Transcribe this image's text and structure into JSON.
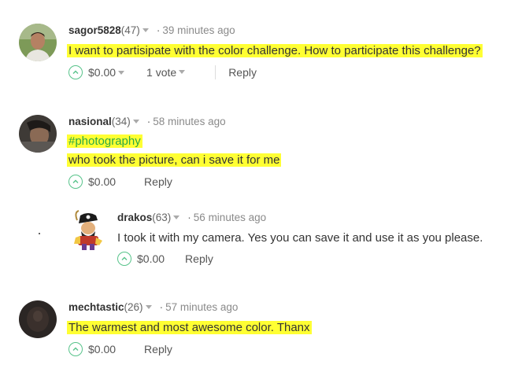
{
  "comments": [
    {
      "author": "sagor5828",
      "reputation": "(47)",
      "time": "39 minutes ago",
      "lines": [
        "I want to partisipate with the color challenge. How to participate this challenge?"
      ],
      "payout": "$0.00",
      "votes": "1 vote",
      "reply": "Reply"
    },
    {
      "author": "nasional",
      "reputation": "(34)",
      "time": "58 minutes ago",
      "tag": "#photography",
      "lines": [
        "who took the picture, can i save it for me"
      ],
      "payout": "$0.00",
      "reply": "Reply"
    },
    {
      "author": "drakos",
      "reputation": "(63)",
      "time": "56 minutes ago",
      "lines": [
        "I took it with my camera. Yes you can save it and use it as you please."
      ],
      "payout": "$0.00",
      "reply": "Reply"
    },
    {
      "author": "mechtastic",
      "reputation": "(26)",
      "time": "57 minutes ago",
      "lines": [
        "The warmest and most awesome color. Thanx"
      ],
      "payout": "$0.00",
      "reply": "Reply"
    }
  ],
  "colors": {
    "highlight": "#ffff33",
    "accent": "#57c38a",
    "tag": "#2aa846"
  }
}
